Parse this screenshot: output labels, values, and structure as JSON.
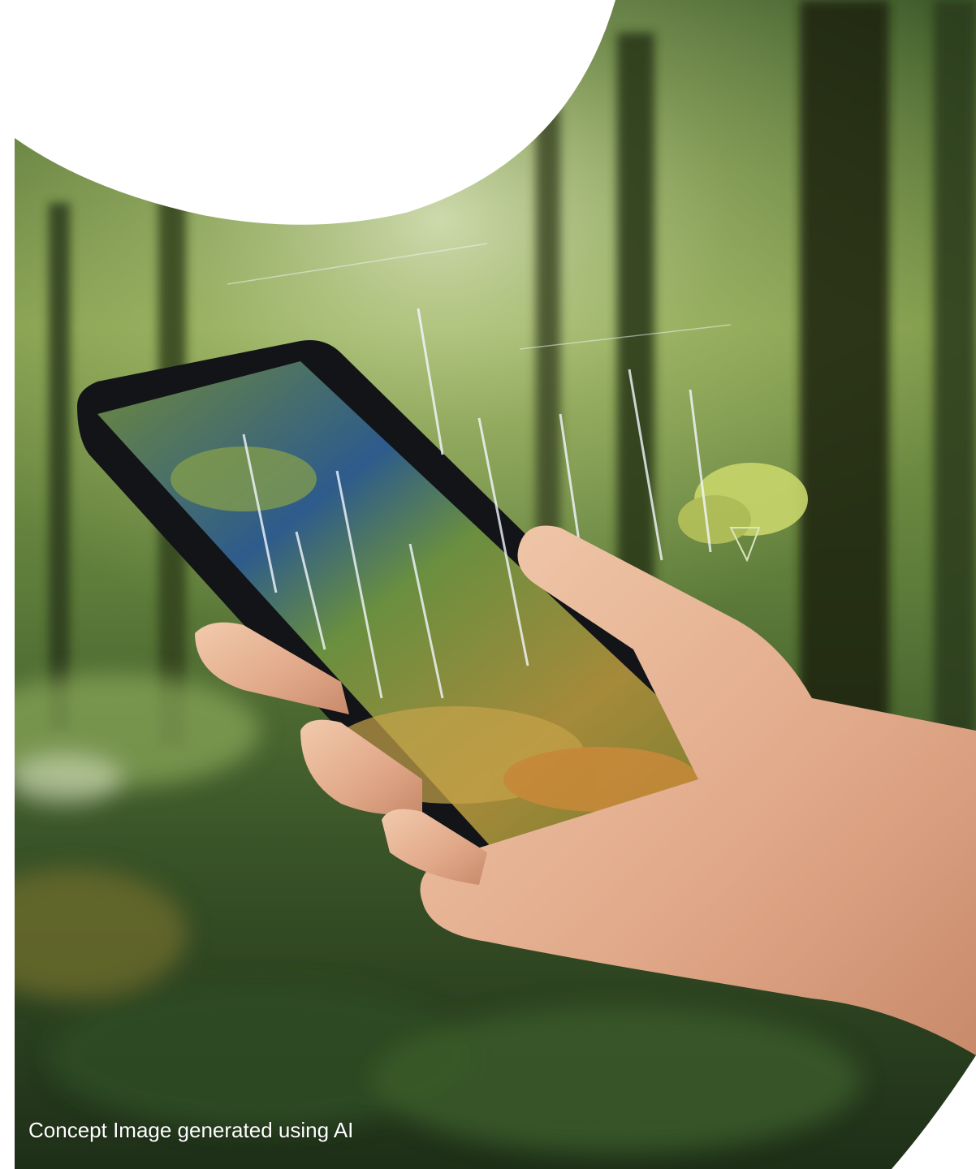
{
  "caption": "Concept Image generated using AI",
  "icons": {
    "phone": "smartphone-icon",
    "hand": "hand-icon",
    "tree": "tree-icon",
    "wind_turbine": "wind-turbine-icon"
  },
  "colors": {
    "forest_dark": "#1f2f1a",
    "forest_mid": "#4f6e34",
    "foliage_light": "#b9cf6a",
    "sky_haze": "#dfe9c9",
    "phone_body": "#121418",
    "skin": "#e8b89a",
    "caption_text": "#ffffff",
    "background": "#ffffff"
  }
}
